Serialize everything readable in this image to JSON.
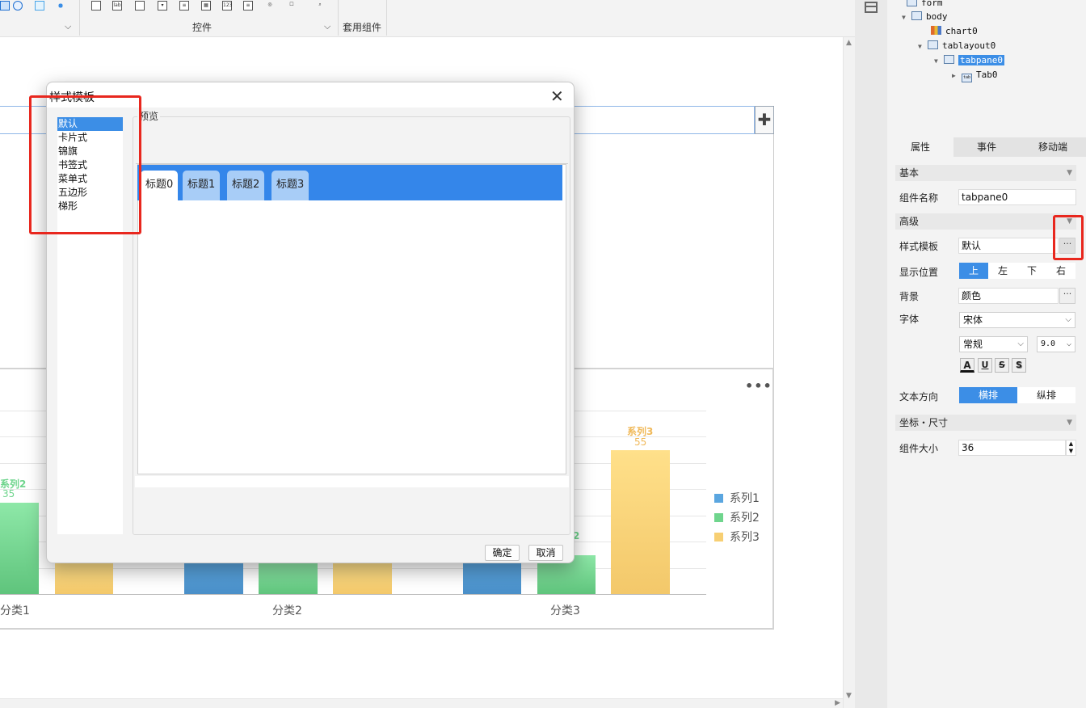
{
  "toolbar": {
    "controls_group_label": "控件",
    "suite_group_label": "套用组件",
    "icon_names": [
      "chart-icon",
      "gauge-icon",
      "widget-icon",
      "scatter-icon",
      "button-icon",
      "label-icon",
      "textfield-icon",
      "combobox-icon",
      "list-icon",
      "table-icon",
      "number-icon",
      "textarea-icon",
      "radio-icon",
      "checkbox-icon",
      "search-icon"
    ]
  },
  "canvas": {
    "add_tab_symbol": "✚",
    "more_symbol": "•••"
  },
  "chart_data": {
    "type": "bar",
    "categories": [
      "分类1",
      "分类2",
      "分类3"
    ],
    "category_labels_visible": [
      "分类1",
      "分类2",
      "分类3"
    ],
    "series": [
      {
        "name": "系列1",
        "color": "#5aa6e0"
      },
      {
        "name": "系列2",
        "color": "#6fd58d"
      },
      {
        "name": "系列3",
        "color": "#f7cf73"
      }
    ],
    "visible_data_labels": [
      {
        "series": "系列2",
        "category": "分类1",
        "label_name": "系列2",
        "value": 35
      },
      {
        "series": "系列3",
        "category": "分类3",
        "label_name": "系列3",
        "value": 55
      }
    ],
    "partial_data_labels": [
      {
        "series": "系列2",
        "category": "分类3",
        "text": "2"
      }
    ],
    "legend": [
      "系列1",
      "系列2",
      "系列3"
    ],
    "legend_position": "right"
  },
  "dialog": {
    "title": "样式模板",
    "close_symbol": "✕",
    "style_list": [
      "默认",
      "卡片式",
      "锦旗",
      "书签式",
      "菜单式",
      "五边形",
      "梯形"
    ],
    "selected_style": "默认",
    "preview_label": "预览",
    "preview_tabs": [
      "标题0",
      "标题1",
      "标题2",
      "标题3"
    ],
    "ok_label": "确定",
    "cancel_label": "取消"
  },
  "tree": {
    "nodes": [
      {
        "label": "form"
      },
      {
        "label": "body"
      },
      {
        "label": "chart0"
      },
      {
        "label": "tablayout0"
      },
      {
        "label": "tabpane0",
        "selected": true
      },
      {
        "label": "Tab0"
      }
    ]
  },
  "panel": {
    "tabs": [
      "属性",
      "事件",
      "移动端"
    ],
    "basic_section": "基本",
    "component_name_label": "组件名称",
    "component_name_value": "tabpane0",
    "advanced_section": "高级",
    "style_template_label": "样式模板",
    "style_template_value": "默认",
    "ellipsis": "···",
    "display_position_label": "显示位置",
    "positions": [
      "上",
      "左",
      "下",
      "右"
    ],
    "active_position": "上",
    "background_label": "背景",
    "background_value": "颜色",
    "font_label": "字体",
    "font_family_value": "宋体",
    "font_style_value": "常规",
    "font_size_value": "9.0",
    "format_buttons": [
      "A",
      "U",
      "S",
      "S"
    ],
    "text_direction_label": "文本方向",
    "directions": [
      "横排",
      "纵排"
    ],
    "active_direction": "横排",
    "coords_section": "坐标・尺寸",
    "component_size_label": "组件大小",
    "component_size_value": "36"
  },
  "colors": {
    "accent": "#3c8ee6",
    "highlight_box": "#e8271e",
    "preview_tabbar": "#3486ea"
  }
}
